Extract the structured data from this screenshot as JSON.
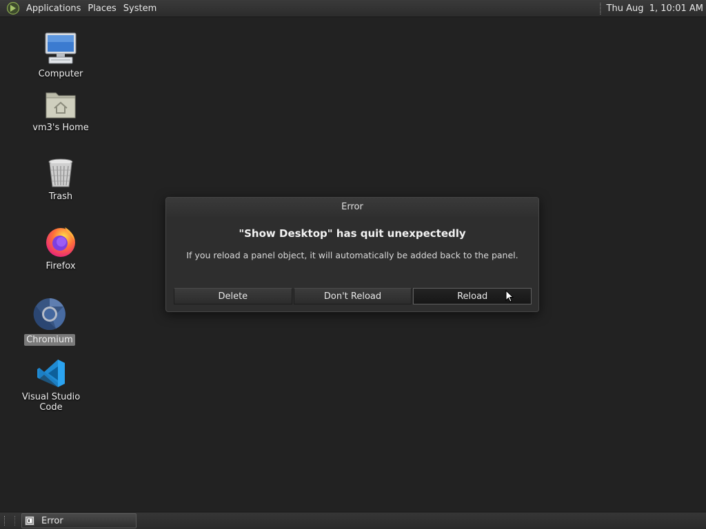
{
  "top_panel": {
    "menus": [
      "Applications",
      "Places",
      "System"
    ],
    "clock": "Thu Aug  1, 10:01 AM"
  },
  "desktop_icons": [
    {
      "label": "Computer",
      "icon": "computer-icon"
    },
    {
      "label": "vm3's Home",
      "icon": "home-folder-icon"
    },
    {
      "label": "Trash",
      "icon": "trash-icon"
    },
    {
      "label": "Firefox",
      "icon": "firefox-icon"
    },
    {
      "label": "Chromium",
      "icon": "chromium-icon",
      "selected": true
    },
    {
      "label": "Visual Studio Code",
      "icon": "vscode-icon"
    }
  ],
  "dialog": {
    "title": "Error",
    "heading": "\"Show Desktop\" has quit unexpectedly",
    "message": "If you reload a panel object, it will automatically be added back to the panel.",
    "buttons": {
      "delete": "Delete",
      "dont_reload": "Don't Reload",
      "reload": "Reload"
    },
    "default_button": "reload"
  },
  "bottom_panel": {
    "task": "Error"
  },
  "colors": {
    "desktop_bg": "#222222",
    "panel_bg": "#2e2e2e",
    "dialog_bg": "#2e2e2e",
    "firefox_orange": "#ff7139",
    "vscode_blue": "#23a8f2"
  }
}
